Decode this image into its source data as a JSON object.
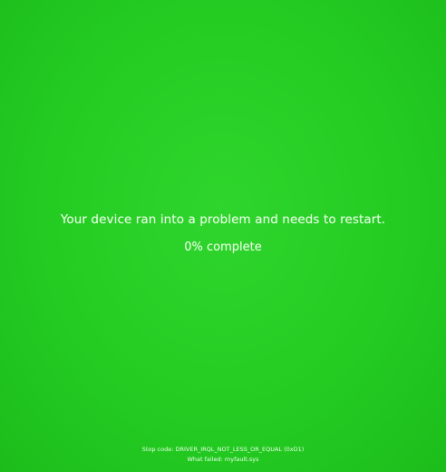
{
  "screen": {
    "background_color": "#24cc22",
    "text_color": "#e9ffe6",
    "message": "Your device ran into a problem and needs to restart.",
    "progress_text": "0% complete",
    "progress_percent": 0,
    "stop_code_line": "Stop code: DRIVER_IRQL_NOT_LESS_OR_EQUAL (0xD1)",
    "what_failed_line": "What failed: myfault.sys"
  }
}
